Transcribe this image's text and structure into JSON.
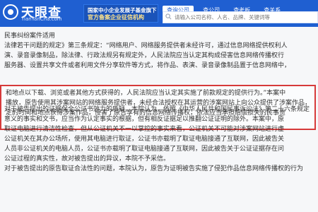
{
  "header": {
    "logo_text": "天眼查",
    "logo_url": "TianYanCha.com",
    "promo_line1": "国家中小企业发展子基金旗下",
    "promo_line2": "官方备案企业征信机构",
    "tabs": [
      "查询公司",
      "查公司",
      "查老板",
      "查关系"
    ],
    "search_placeholder": "请输入公司名称、人名、品牌、关键词等"
  },
  "article": {
    "heading": "民事纠纷案件适用",
    "lines_before": [
      "法律若干问题的规定》第三条规定：“网络用户、网络服务提供者未经许可，通过信息网络提供权利人",
      "演、录音录像制品，除法律、行政法规另有规定外，人民法院应当认定其构成侵害信息网络传播权行",
      "服务器、设置共享文件或者利用文件分享软件等方式，将作品、表演、录音录像制品置于信息网络中，"
    ],
    "highlight_lines": [
      "和地点以下载、浏览或者其他方式获得的，人民法院应当认定其实施了前款规定的提供行为。”本案中",
      "播放，原告使用其涉案网站的网络服务提供者，未经合法授权在其运营的涉案网站上向公众提供了涉案作品，",
      "定的时间和地点获得涉案作品，侵害了原告享有的信息网络传播权，依法应当承担赔偿损失的民事责"
    ],
    "lines_after": [
      "对于被告提出的证据保全公证书效力的质疑，本院认为，依照《中华人民共和国民事诉讼法》第二十六条规定",
      "意义的事实和文书，应当作为认定事实的根据，但有相反证据足以推翻公证证明的除外。本案中，原",
      "取证电脑进行清洁性检查，但从公证机关不一以掌控的事实来看，公证机关不可能对涉案网站进行虚",
      "公证机关在其办公场所，使用其电脑进行取证，公证书亦载明了取证电脑接通了互联网，因此被告关",
      "人员非公证机关的电脑人员，公证书亦载明了取证电脑接通了互联网，因此被告关于公证证据存在问",
      "公证过程的真实性，故对被告提出的异议，本院不予采信。",
      "对于被告提出的原告取证合法性的问题，本院认为，原告为证明被告实施了侵犯作品信息网络传播权的行为"
    ]
  }
}
